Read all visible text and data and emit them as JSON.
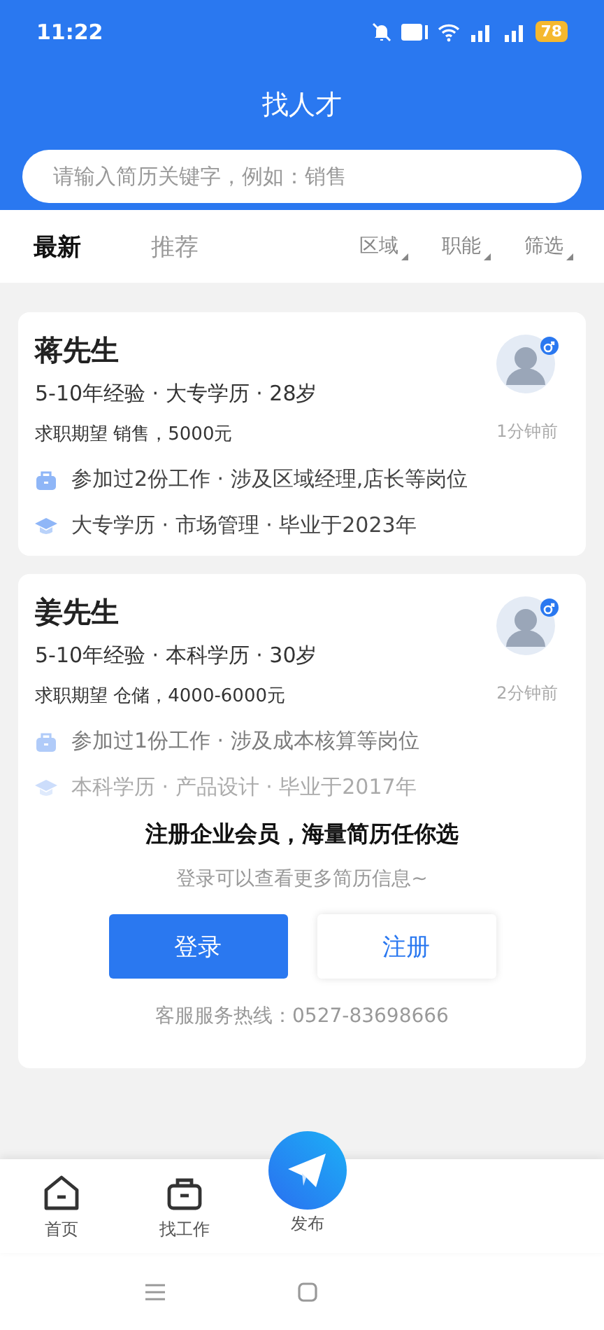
{
  "status_bar": {
    "time": "11:22",
    "battery": "78"
  },
  "header": {
    "title": "找人才"
  },
  "search": {
    "placeholder": "请输入简历关键字，例如：销售"
  },
  "tabs": [
    {
      "label": "最新",
      "selected": true
    },
    {
      "label": "推荐",
      "selected": false
    }
  ],
  "filters": [
    "区域",
    "职能",
    "筛选"
  ],
  "resumes": [
    {
      "name": "蒋先生",
      "summary": "5-10年经验 · 大专学历 · 28岁",
      "expectation": "求职期望 销售，5000元",
      "time": "1分钟前",
      "work": "参加过2份工作 · 涉及区域经理,店长等岗位",
      "education": "大专学历 · 市场管理 · 毕业于2023年",
      "faded": false
    },
    {
      "name": "姜先生",
      "summary": "5-10年经验 · 本科学历 · 30岁",
      "expectation": "求职期望 仓储，4000-6000元",
      "time": "2分钟前",
      "work": "参加过1份工作 · 涉及成本核算等岗位",
      "education": "本科学历 · 产品设计 · 毕业于2017年",
      "faded": true
    }
  ],
  "login_prompt": {
    "title": "注册企业会员，海量简历任你选",
    "subtitle": "登录可以查看更多简历信息~",
    "buttons": [
      {
        "label": "登录",
        "kind": "primary"
      },
      {
        "label": "注册",
        "kind": "secondary"
      }
    ],
    "hotline": "客服服务热线：0527-83698666"
  },
  "bottom_nav": [
    {
      "label": "首页",
      "kind": "home"
    },
    {
      "label": "找工作",
      "kind": "jobs"
    },
    {
      "label": "发布",
      "kind": "publish"
    }
  ]
}
